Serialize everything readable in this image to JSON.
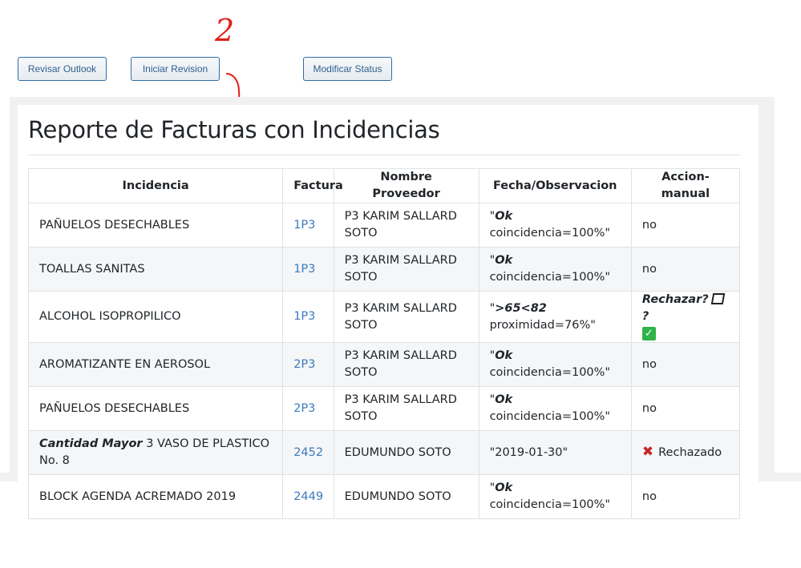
{
  "toolbar": {
    "revisar_label": "Revisar Outlook",
    "iniciar_label": "Iniciar Revision",
    "modificar_label": "Modificar Status"
  },
  "page": {
    "title": "Reporte de Facturas con Incidencias"
  },
  "table": {
    "headers": [
      "Incidencia",
      "Factura",
      "Nombre Proveedor",
      "Fecha/Observacion",
      "Accion-manual"
    ],
    "rows": [
      {
        "incidencia": "PAÑUELOS DESECHABLES",
        "factura": "1P3",
        "proveedor": "P3 KARIM SALLARD SOTO",
        "obs_bold": "Ok",
        "obs_text": "coincidencia=100%\"",
        "accion": "no"
      },
      {
        "incidencia": "TOALLAS SANITAS",
        "factura": "1P3",
        "proveedor": "P3 KARIM SALLARD SOTO",
        "obs_bold": "Ok",
        "obs_text": "coincidencia=100%\"",
        "accion": "no"
      },
      {
        "incidencia": "ALCOHOL ISOPROPILICO",
        "factura": "1P3",
        "proveedor": "P3 KARIM SALLARD SOTO",
        "obs_bold": ">65<82",
        "obs_text": "proximidad=76%\"",
        "accion_bold": "Rechazar?",
        "accion_q": "?"
      },
      {
        "incidencia": "AROMATIZANTE EN AEROSOL",
        "factura": "2P3",
        "proveedor": "P3 KARIM SALLARD SOTO",
        "obs_bold": "Ok",
        "obs_text": "coincidencia=100%\"",
        "accion": "no"
      },
      {
        "incidencia": "PAÑUELOS DESECHABLES",
        "factura": "2P3",
        "proveedor": "P3 KARIM SALLARD SOTO",
        "obs_bold": "Ok",
        "obs_text": "coincidencia=100%\"",
        "accion": "no"
      },
      {
        "incidencia_bold": "Cantidad Mayor",
        "incidencia": "3 VASO DE PLASTICO No. 8",
        "factura": "2452",
        "proveedor": "EDUMUNDO SOTO",
        "obs": "\"2019-01-30\"",
        "accion": "Rechazado"
      },
      {
        "incidencia": "BLOCK AGENDA ACREMADO 2019",
        "factura": "2449",
        "proveedor": "EDUMUNDO SOTO",
        "obs_bold": "Ok",
        "obs_text": "coincidencia=100%\"",
        "accion": "no"
      }
    ],
    "quote": "\""
  },
  "annotation": {
    "step": "2",
    "color": "#e0201b"
  }
}
